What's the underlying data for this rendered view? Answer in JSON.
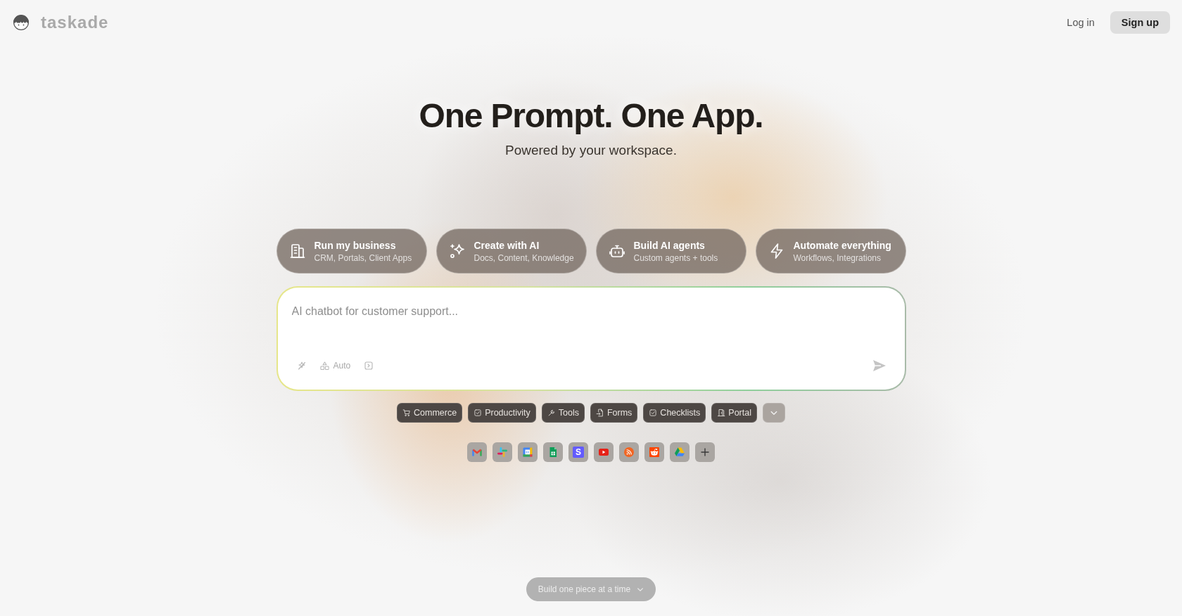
{
  "header": {
    "logo": "taskade",
    "login": "Log in",
    "signup": "Sign up"
  },
  "hero": {
    "title": "One Prompt. One App.",
    "subtitle": "Powered by your workspace."
  },
  "categories": [
    {
      "kind": "building",
      "title": "Run my business",
      "subtitle": "CRM, Portals, Client Apps"
    },
    {
      "kind": "sparkles",
      "title": "Create with AI",
      "subtitle": "Docs, Content, Knowledge"
    },
    {
      "kind": "robot",
      "title": "Build AI agents",
      "subtitle": "Custom agents + tools"
    },
    {
      "kind": "bolt",
      "title": "Automate everything",
      "subtitle": "Workflows, Integrations"
    }
  ],
  "prompt": {
    "placeholder": "AI chatbot for customer support...",
    "model": "Auto"
  },
  "templates": [
    {
      "kind": "cart",
      "label": "Commerce"
    },
    {
      "kind": "check",
      "label": "Productivity"
    },
    {
      "kind": "wrench",
      "label": "Tools"
    },
    {
      "kind": "document",
      "label": "Forms"
    },
    {
      "kind": "check",
      "label": "Checklists"
    },
    {
      "kind": "door",
      "label": "Portal"
    }
  ],
  "integrations": [
    {
      "kind": "m-logo"
    },
    {
      "kind": "hash-logo"
    },
    {
      "kind": "calendar"
    },
    {
      "kind": "sheet"
    },
    {
      "kind": "letter",
      "text": "S"
    },
    {
      "kind": "video"
    },
    {
      "kind": "rss"
    },
    {
      "kind": "alien"
    },
    {
      "kind": "triangle"
    },
    {
      "kind": "add"
    }
  ],
  "footer": {
    "button": "Build one piece at a time"
  }
}
